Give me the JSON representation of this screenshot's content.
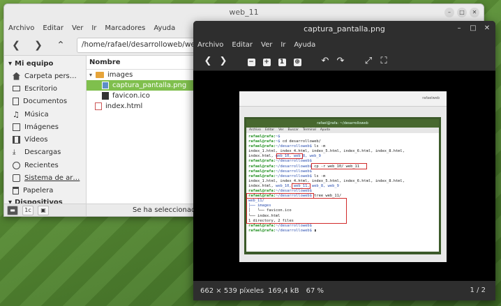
{
  "fm": {
    "title": "web_11",
    "menu": [
      "Archivo",
      "Editar",
      "Ver",
      "Ir",
      "Marcadores",
      "Ayuda"
    ],
    "path": "/home/rafael/desarrolloweb/web_11",
    "sidebar_heading": "Mi equipo",
    "sidebar_items": [
      {
        "label": "Carpeta pers…",
        "icon": "home-icon"
      },
      {
        "label": "Escritorio",
        "icon": "desktop-icon"
      },
      {
        "label": "Documentos",
        "icon": "documents-icon"
      },
      {
        "label": "Música",
        "icon": "music-icon"
      },
      {
        "label": "Imágenes",
        "icon": "pictures-icon"
      },
      {
        "label": "Vídeos",
        "icon": "videos-icon"
      },
      {
        "label": "Descargas",
        "icon": "downloads-icon"
      },
      {
        "label": "Recientes",
        "icon": "recent-icon"
      },
      {
        "label": "Sistema de ar…",
        "icon": "filesystem-icon"
      },
      {
        "label": "Papelera",
        "icon": "trash-icon"
      },
      {
        "label": "Dispositivos",
        "icon": "devices-icon"
      }
    ],
    "column_header": "Nombre",
    "files": [
      {
        "name": "images",
        "type": "folder"
      },
      {
        "name": "captura_pantalla.png",
        "type": "image"
      },
      {
        "name": "favicon.ico",
        "type": "icon"
      },
      {
        "name": "index.html",
        "type": "html"
      }
    ],
    "selected_file": "captura_pantalla.png",
    "status": "Se ha seleccionado «c"
  },
  "viewer": {
    "title": "captura_pantalla.png",
    "menu": [
      "Archivo",
      "Editar",
      "Ver",
      "Ir",
      "Ayuda"
    ],
    "status_dimensions": "662 × 539 píxeles",
    "status_size": "169,4 kB",
    "status_zoom": "67 %",
    "page_counter": "1 / 2"
  },
  "screenshot": {
    "user": "rafaelweb",
    "terminal_title": "rafael@rafa: ~/desarrolloweb",
    "terminal_menu": [
      "Archivo",
      "Editar",
      "Ver",
      "Buscar",
      "Terminal",
      "Ayuda"
    ],
    "prompt": "rafael@rafa:",
    "lines": [
      {
        "path": "~$",
        "cmd": ""
      },
      {
        "path": "~$",
        "cmd": " cd desarrolloweb/"
      },
      {
        "path": "~/desarrolloweb$",
        "cmd": " ls -m"
      },
      {
        "out": "index_1.html, index_4.html, index_5.html, index_6.html, index_8.html,"
      },
      {
        "out": "index.html, ",
        "dirs": "web_10, web_8, web_9"
      },
      {
        "path": "~/desarrolloweb$",
        "cmd": ""
      },
      {
        "path": "~/desarrolloweb$",
        "cmd": " cp -r web_10/ web_11"
      },
      {
        "path": "~/desarrolloweb$",
        "cmd": ""
      },
      {
        "path": "~/desarrolloweb$",
        "cmd": " ls -m"
      },
      {
        "out": "index_1.html, index_4.html, index_5.html, index_6.html, index_8.html,"
      },
      {
        "out": "index.html, ",
        "dirs": "web_10, web_11, web_8, web_9"
      },
      {
        "path": "~/desarrolloweb$",
        "cmd": ""
      },
      {
        "path": "~/desarrolloweb$",
        "cmd": " tree web_11/"
      },
      {
        "tree": "web_11/"
      },
      {
        "tree": "├── images"
      },
      {
        "tree": "│   └── favicon.ico"
      },
      {
        "out": "└── index.html"
      },
      {
        "out": ""
      },
      {
        "out": "1 directory, 2 files"
      },
      {
        "path": "~/desarrolloweb$",
        "cmd": ""
      },
      {
        "path": "~/desarrolloweb$",
        "cmd": " ▮"
      }
    ]
  }
}
